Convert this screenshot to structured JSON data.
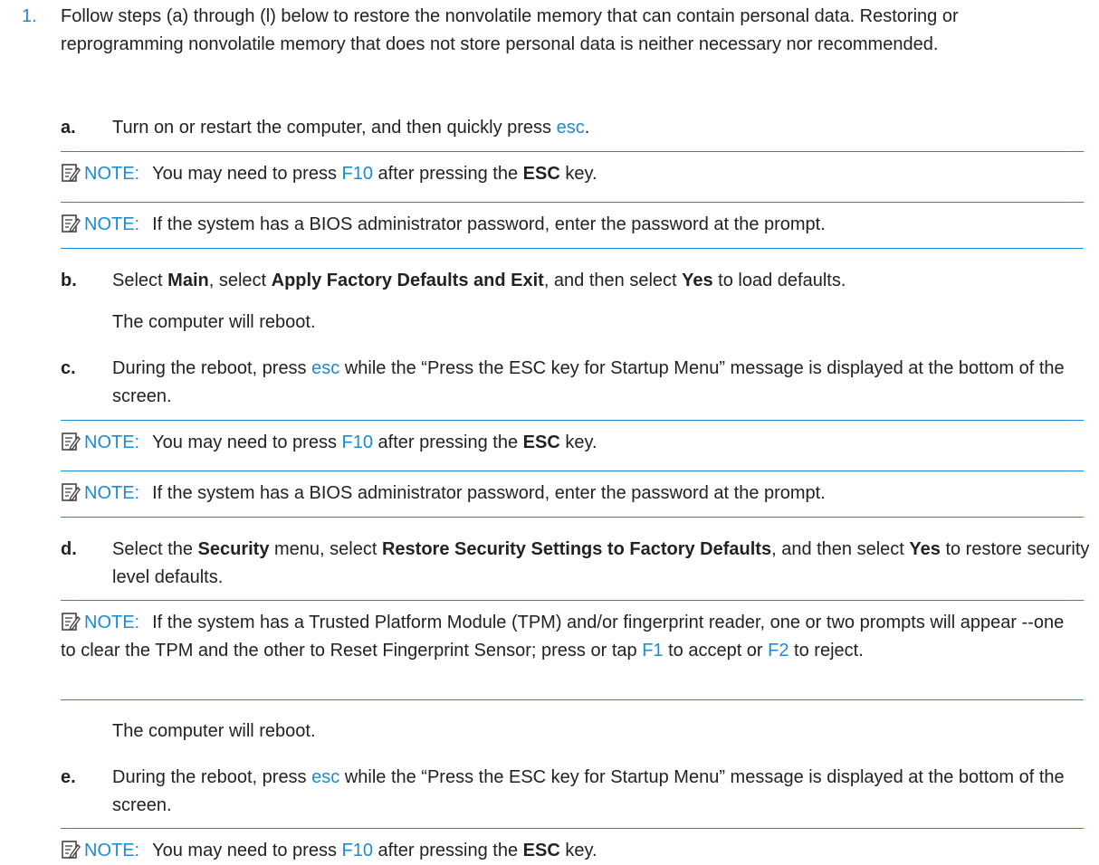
{
  "step1": {
    "number": "1.",
    "text": "Follow steps (a) through (l) below to restore the nonvolatile memory that can contain personal data. Restoring or reprogramming nonvolatile memory that does not store personal data is neither necessary nor recommended."
  },
  "note_label": "NOTE:",
  "step_a": {
    "letter": "a.",
    "text_before": "Turn on or restart the computer, and then quickly press ",
    "key": "esc",
    "text_after": "."
  },
  "note_f10": {
    "before": "You may need to press ",
    "key": "F10",
    "middle": " after pressing the ",
    "bold": "ESC",
    "after": " key."
  },
  "note_bios": {
    "text": "If the system has a BIOS administrator password, enter the password at the prompt."
  },
  "step_b": {
    "letter": "b.",
    "t1": "Select ",
    "b1": "Main",
    "t2": ", select ",
    "b2": "Apply Factory Defaults and Exit",
    "t3": ", and then select ",
    "b3": "Yes",
    "t4": " to load defaults.",
    "follow": "The computer will reboot."
  },
  "step_c": {
    "letter": "c.",
    "t1": "During the reboot, press ",
    "key": "esc",
    "t2": " while the “Press the ESC key for Startup Menu” message is displayed at the bottom of the screen."
  },
  "step_d": {
    "letter": "d.",
    "t1": "Select the ",
    "b1": "Security",
    "t2": " menu, select ",
    "b2": "Restore Security Settings to Factory Defaults",
    "t3": ", and then select ",
    "b3": "Yes",
    "t4": " to restore security level defaults.",
    "follow": "The computer will reboot."
  },
  "note_tpm": {
    "t1": "If the system has a Trusted Platform Module (TPM) and/or fingerprint reader, one or two prompts will appear --one to clear the TPM and the other to Reset Fingerprint Sensor; press or tap ",
    "k1": "F1",
    "t2": " to accept or ",
    "k2": "F2",
    "t3": " to reject."
  },
  "step_e": {
    "letter": "e.",
    "t1": "During the reboot, press ",
    "key": "esc",
    "t2": " while the “Press the ESC key for Startup Menu” message is displayed at the bottom of the screen."
  },
  "colors": {
    "accent": "#1a8bd6",
    "text": "#222222"
  },
  "icons": {
    "note": "note-pencil-icon"
  }
}
